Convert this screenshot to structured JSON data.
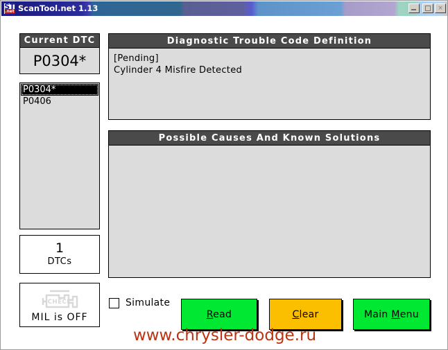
{
  "window": {
    "title": "ScanTool.net 1.13",
    "icon_name": "scantool-app-icon",
    "icon_text_primary": "ST",
    "icon_text_secondary": ".net",
    "controls": {
      "minimize_label": "Minimize",
      "maximize_label": "Maximize",
      "close_label": "×"
    }
  },
  "sidebar": {
    "current_dtc": {
      "header": "Current DTC",
      "value": "P0304*"
    },
    "dtc_list": [
      {
        "code": "P0304*",
        "selected": true
      },
      {
        "code": "P0406",
        "selected": false
      }
    ],
    "dtc_count": {
      "number": "1",
      "label": "DTCs"
    },
    "mil": {
      "icon_name": "check-engine-icon",
      "icon_text": "CHECK",
      "label": "MIL is OFF"
    }
  },
  "panels": {
    "definition": {
      "header": "Diagnostic Trouble Code Definition",
      "body": "[Pending]\nCylinder 4 Misfire Detected"
    },
    "causes": {
      "header": "Possible Causes And Known Solutions",
      "body": ""
    }
  },
  "controls": {
    "simulate": {
      "label": "Simulate",
      "checked": false
    },
    "buttons": [
      {
        "name": "read",
        "prefix": "",
        "accel": "R",
        "suffix": "ead",
        "color": "#00e831"
      },
      {
        "name": "clear",
        "prefix": "",
        "accel": "C",
        "suffix": "lear",
        "color": "#fcbf00"
      },
      {
        "name": "main-menu",
        "prefix": "Main ",
        "accel": "M",
        "suffix": "enu",
        "color": "#00e831"
      }
    ]
  },
  "watermark": {
    "text": "www.chrysler-dodge.ru",
    "color": "#bb3311"
  }
}
